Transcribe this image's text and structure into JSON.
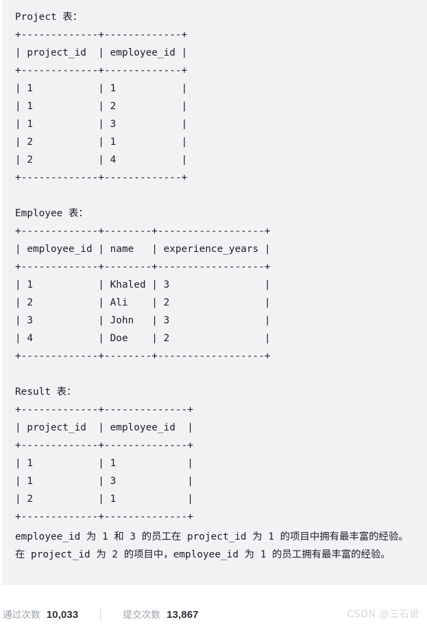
{
  "code_block": {
    "background_color": "#f1f2f4",
    "text_color": "#1b1b28",
    "sections": [
      {
        "title": "Project 表：",
        "table_text": "+-------------+-------------+\n| project_id  | employee_id |\n+-------------+-------------+\n| 1           | 1           |\n| 1           | 2           |\n| 1           | 3           |\n| 2           | 1           |\n| 2           | 4           |\n+-------------+-------------+"
      },
      {
        "title": "Employee 表：",
        "table_text": "+-------------+--------+------------------+\n| employee_id | name   | experience_years |\n+-------------+--------+------------------+\n| 1           | Khaled | 3                |\n| 2           | Ali    | 2                |\n| 3           | John   | 3                |\n| 4           | Doe    | 2                |\n+-------------+--------+------------------+"
      },
      {
        "title": "Result 表：",
        "table_text": "+-------------+--------------+\n| project_id  | employee_id  |\n+-------------+--------------+\n| 1           | 1            |\n| 1           | 3            |\n| 2           | 1            |\n+-------------+--------------+"
      }
    ],
    "tables": [
      {
        "name": "Project",
        "columns": [
          "project_id",
          "employee_id"
        ],
        "rows": [
          [
            "1",
            "1"
          ],
          [
            "1",
            "2"
          ],
          [
            "1",
            "3"
          ],
          [
            "2",
            "1"
          ],
          [
            "2",
            "4"
          ]
        ]
      },
      {
        "name": "Employee",
        "columns": [
          "employee_id",
          "name",
          "experience_years"
        ],
        "rows": [
          [
            "1",
            "Khaled",
            "3"
          ],
          [
            "2",
            "Ali",
            "2"
          ],
          [
            "3",
            "John",
            "3"
          ],
          [
            "4",
            "Doe",
            "2"
          ]
        ]
      },
      {
        "name": "Result",
        "columns": [
          "project_id",
          "employee_id"
        ],
        "rows": [
          [
            "1",
            "1"
          ],
          [
            "1",
            "3"
          ],
          [
            "2",
            "1"
          ]
        ]
      }
    ],
    "explanation": "employee_id 为 1 和 3 的员工在 project_id 为 1 的项目中拥有最丰富的经验。在 project_id 为 2 的项目中，employee_id 为 1 的员工拥有最丰富的经验。"
  },
  "stats": {
    "accepted": {
      "label": "通过次数",
      "value": "10,033"
    },
    "submissions": {
      "label": "提交次数",
      "value": "13,867"
    }
  },
  "watermark": {
    "text": "CSDN @三石说",
    "color": "#d4d6da"
  }
}
